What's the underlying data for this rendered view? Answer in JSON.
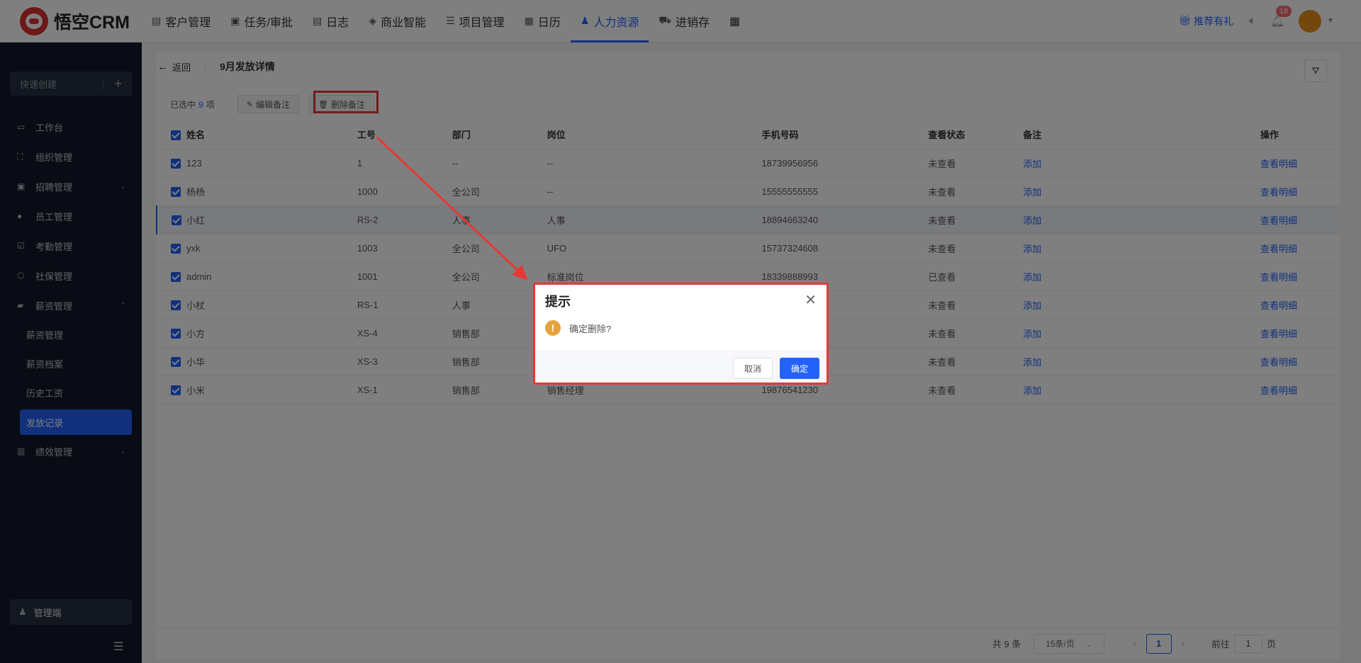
{
  "app": {
    "logo_text": "悟空CRM"
  },
  "nav": {
    "items": [
      {
        "label": "客户管理",
        "icon": "document-icon",
        "glyph": "▤"
      },
      {
        "label": "任务/审批",
        "icon": "briefcase-icon",
        "glyph": "▣"
      },
      {
        "label": "日志",
        "icon": "note-icon",
        "glyph": "▤"
      },
      {
        "label": "商业智能",
        "icon": "compass-icon",
        "glyph": "◈"
      },
      {
        "label": "项目管理",
        "icon": "list-icon",
        "glyph": "☰"
      },
      {
        "label": "日历",
        "icon": "calendar-icon",
        "glyph": "▦"
      },
      {
        "label": "人力资源",
        "icon": "people-icon",
        "glyph": "♟"
      },
      {
        "label": "进销存",
        "icon": "truck-icon",
        "glyph": "⛟"
      }
    ],
    "apps_glyph": "▦",
    "recommend": "推荐有礼",
    "notify_count": "18"
  },
  "sidebar": {
    "quick_create": "快速创建",
    "menu": [
      {
        "label": "工作台",
        "glyph": "▭"
      },
      {
        "label": "组织管理",
        "glyph": "⛶"
      },
      {
        "label": "招聘管理",
        "glyph": "▣",
        "arrow": "⌄"
      },
      {
        "label": "员工管理",
        "glyph": "●"
      },
      {
        "label": "考勤管理",
        "glyph": "☑"
      },
      {
        "label": "社保管理",
        "glyph": "⬡"
      },
      {
        "label": "薪资管理",
        "glyph": "▰",
        "arrow": "⌃"
      }
    ],
    "submenu": [
      "薪资管理",
      "薪资档案",
      "历史工资",
      "发放记录"
    ],
    "last_menu": {
      "label": "绩效管理",
      "glyph": "▥",
      "arrow": "⌄"
    },
    "admin": "管理端"
  },
  "page": {
    "back": "返回",
    "title": "9月发放详情",
    "selected_prefix": "已选中",
    "selected_count": "9",
    "selected_suffix": "项",
    "edit_note": "编辑备注",
    "delete_note": "删除备注"
  },
  "table": {
    "headers": [
      "姓名",
      "工号",
      "部门",
      "岗位",
      "手机号码",
      "查看状态",
      "备注",
      "操作"
    ],
    "rows": [
      [
        "123",
        "1",
        "--",
        "--",
        "18739956956",
        "未查看",
        "添加",
        "查看明细"
      ],
      [
        "杨杨",
        "1000",
        "全公司",
        "--",
        "15555555555",
        "未查看",
        "添加",
        "查看明细"
      ],
      [
        "小红",
        "RS-2",
        "人事",
        "人事",
        "18894663240",
        "未查看",
        "添加",
        "查看明细"
      ],
      [
        "yxk",
        "1003",
        "全公司",
        "UFO",
        "15737324608",
        "未查看",
        "添加",
        "查看明细"
      ],
      [
        "admin",
        "1001",
        "全公司",
        "标准岗位",
        "18339888993",
        "已查看",
        "添加",
        "查看明细"
      ],
      [
        "小杖",
        "RS-1",
        "人事",
        "",
        "",
        "未查看",
        "添加",
        "查看明细"
      ],
      [
        "小方",
        "XS-4",
        "销售部",
        "",
        "",
        "未查看",
        "添加",
        "查看明细"
      ],
      [
        "小华",
        "XS-3",
        "销售部",
        "",
        "",
        "未查看",
        "添加",
        "查看明细"
      ],
      [
        "小米",
        "XS-1",
        "销售部",
        "销售经理",
        "19876541230",
        "未查看",
        "添加",
        "查看明细"
      ]
    ]
  },
  "pager": {
    "total": "共 9 条",
    "page_size": "15条/页",
    "current": "1",
    "goto_prefix": "前往",
    "goto_value": "1",
    "goto_suffix": "页"
  },
  "dialog": {
    "title": "提示",
    "message": "确定删除?",
    "cancel": "取消",
    "ok": "确定"
  },
  "colors": {
    "accent": "#2362fb",
    "annotation": "#e53935",
    "warning": "#e6a23c"
  }
}
